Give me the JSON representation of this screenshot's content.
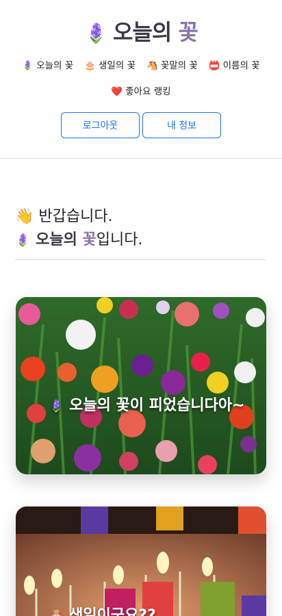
{
  "header": {
    "logo_icon": "🪻",
    "logo_part1": "오늘의 ",
    "logo_part2": "꽃"
  },
  "nav": {
    "items": [
      {
        "icon": "🪻",
        "label": "오늘의 꽃"
      },
      {
        "icon": "🎂",
        "label": "생일의 꽃"
      },
      {
        "icon": "🐴",
        "label": "꽃말의 꽃"
      },
      {
        "icon": "📛",
        "label": "이름의 꽃"
      },
      {
        "icon": "❤️",
        "label": "좋아요 랭킹"
      }
    ]
  },
  "auth": {
    "logout_label": "로그아웃",
    "myinfo_label": "내 정보"
  },
  "welcome": {
    "wave_icon": "👋",
    "greeting": "반갑습니다.",
    "flower_icon": "🪻",
    "title_part1": "오늘의 ",
    "title_part2": "꽃",
    "title_suffix": "입니다."
  },
  "cards": [
    {
      "icon": "🪻",
      "caption": "오늘의 꽃이 피었습니다아~"
    },
    {
      "icon": "🎂",
      "caption": "생일이군요??"
    }
  ],
  "colors": {
    "accent": "#1a73e8",
    "purple": "#8a74a8"
  }
}
